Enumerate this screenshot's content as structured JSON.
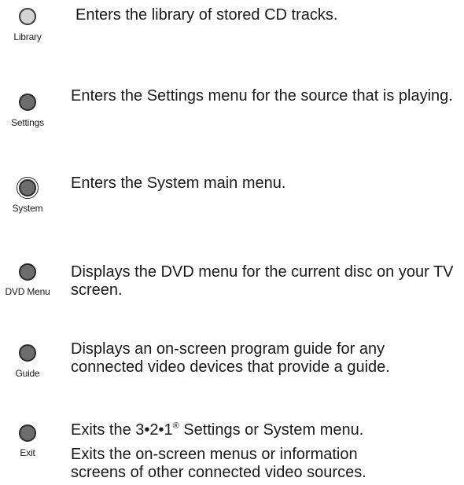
{
  "entries": [
    {
      "id": "library",
      "label": "Library",
      "descriptions": [
        "Enters the library of stored CD tracks."
      ]
    },
    {
      "id": "settings",
      "label": "Settings",
      "descriptions": [
        "Enters the Settings menu for the source that is playing."
      ]
    },
    {
      "id": "system",
      "label": "System",
      "descriptions": [
        "Enters the System main menu."
      ]
    },
    {
      "id": "dvd-menu",
      "label": "DVD Menu",
      "descriptions": [
        "Displays the DVD menu for the current disc on your TV screen."
      ]
    },
    {
      "id": "guide",
      "label": "Guide",
      "descriptions": [
        "Displays an on-screen program guide for any connected video devices that provide a guide."
      ]
    },
    {
      "id": "exit",
      "label": "Exit",
      "descriptions": [
        {
          "before": "Exits the 3•2•1",
          "sup": "®",
          "after": " Settings or System menu."
        },
        "Exits the on-screen menus or information screens of other connected video sources."
      ]
    }
  ]
}
